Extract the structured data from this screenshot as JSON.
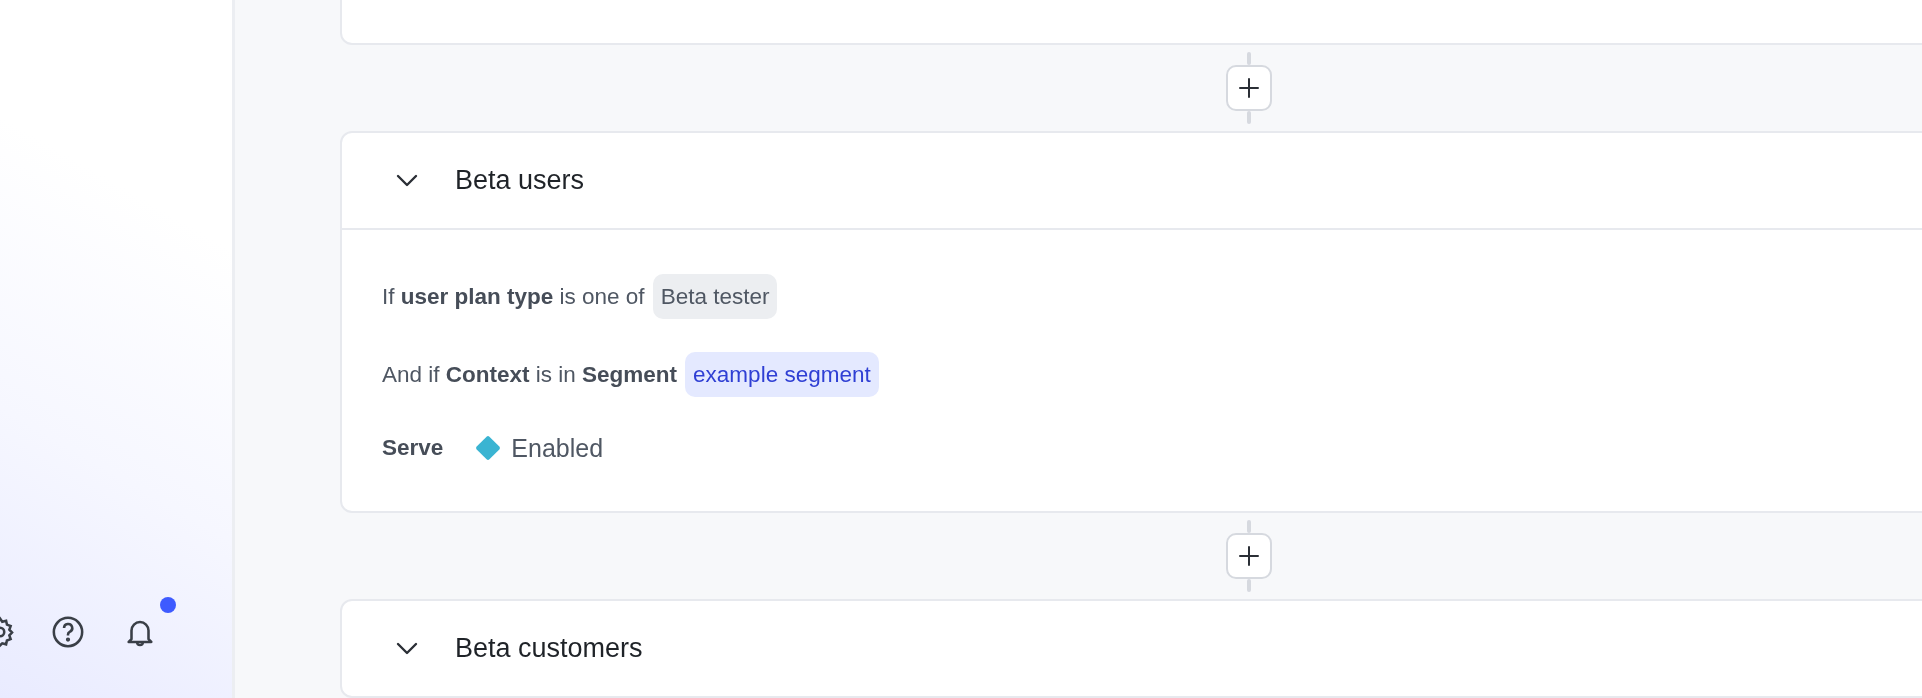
{
  "sidebar": {
    "notification_dot": true
  },
  "rules": [
    {
      "kind": "clipped"
    },
    {
      "kind": "full",
      "title": "Beta users",
      "conditions": [
        {
          "text": "If **user plan type** is one of",
          "chips": [
            {
              "kind": "value",
              "label": "Beta tester"
            }
          ]
        },
        {
          "text": "And if **Context** is in **Segment**",
          "chips": [
            {
              "kind": "segment",
              "label": "example segment"
            }
          ]
        }
      ],
      "serve": {
        "label": "Serve",
        "variation": "Enabled",
        "color": "#3ab4d2"
      }
    },
    {
      "kind": "header",
      "title": "Beta customers"
    }
  ]
}
